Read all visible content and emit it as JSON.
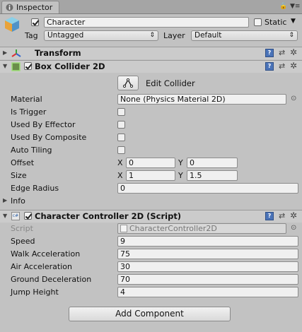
{
  "tab": {
    "label": "Inspector"
  },
  "header": {
    "object_name": "Character",
    "static_label": "Static",
    "tag_label": "Tag",
    "tag_value": "Untagged",
    "layer_label": "Layer",
    "layer_value": "Default"
  },
  "transform": {
    "title": "Transform"
  },
  "box_collider": {
    "title": "Box Collider 2D",
    "edit_collider_label": "Edit Collider",
    "props": {
      "material": {
        "label": "Material",
        "value": "None (Physics Material 2D)"
      },
      "is_trigger": "Is Trigger",
      "used_by_effector": "Used By Effector",
      "used_by_composite": "Used By Composite",
      "auto_tiling": "Auto Tiling",
      "offset": {
        "label": "Offset",
        "x_label": "X",
        "x": "0",
        "y_label": "Y",
        "y": "0"
      },
      "size": {
        "label": "Size",
        "x_label": "X",
        "x": "1",
        "y_label": "Y",
        "y": "1.5"
      },
      "edge_radius": {
        "label": "Edge Radius",
        "value": "0"
      },
      "info": "Info"
    }
  },
  "controller": {
    "title": "Character Controller 2D (Script)",
    "script_label": "Script",
    "script_value": "CharacterController2D",
    "fields": [
      {
        "label": "Speed",
        "value": "9"
      },
      {
        "label": "Walk Acceleration",
        "value": "75"
      },
      {
        "label": "Air Acceleration",
        "value": "30"
      },
      {
        "label": "Ground Deceleration",
        "value": "70"
      },
      {
        "label": "Jump Height",
        "value": "4"
      }
    ]
  },
  "add_component_label": "Add Component",
  "icon_glyphs": {
    "help": "?",
    "gear": "✲",
    "fold_open": "▼",
    "fold_closed": "▶",
    "dropdown": "▼",
    "menu": "▼≡",
    "script_badge": "c#"
  }
}
